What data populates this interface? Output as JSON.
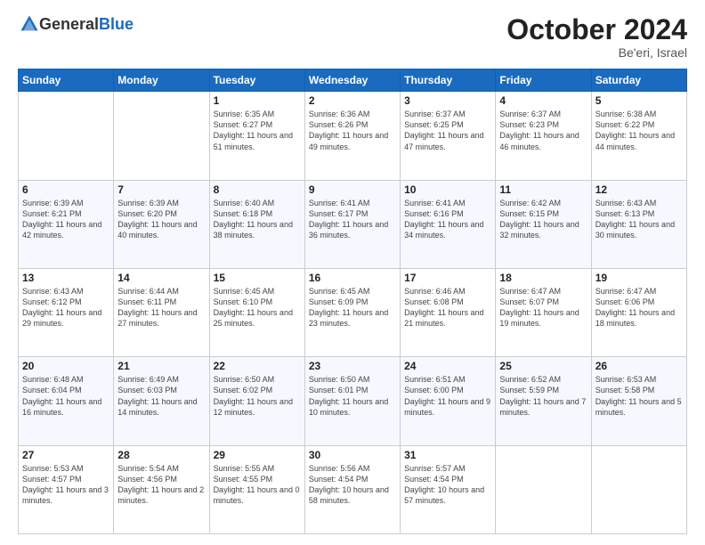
{
  "header": {
    "logo_general": "General",
    "logo_blue": "Blue",
    "month": "October 2024",
    "location": "Be'eri, Israel"
  },
  "days_of_week": [
    "Sunday",
    "Monday",
    "Tuesday",
    "Wednesday",
    "Thursday",
    "Friday",
    "Saturday"
  ],
  "weeks": [
    [
      {
        "day": "",
        "sunrise": "",
        "sunset": "",
        "daylight": ""
      },
      {
        "day": "",
        "sunrise": "",
        "sunset": "",
        "daylight": ""
      },
      {
        "day": "1",
        "sunrise": "Sunrise: 6:35 AM",
        "sunset": "Sunset: 6:27 PM",
        "daylight": "Daylight: 11 hours and 51 minutes."
      },
      {
        "day": "2",
        "sunrise": "Sunrise: 6:36 AM",
        "sunset": "Sunset: 6:26 PM",
        "daylight": "Daylight: 11 hours and 49 minutes."
      },
      {
        "day": "3",
        "sunrise": "Sunrise: 6:37 AM",
        "sunset": "Sunset: 6:25 PM",
        "daylight": "Daylight: 11 hours and 47 minutes."
      },
      {
        "day": "4",
        "sunrise": "Sunrise: 6:37 AM",
        "sunset": "Sunset: 6:23 PM",
        "daylight": "Daylight: 11 hours and 46 minutes."
      },
      {
        "day": "5",
        "sunrise": "Sunrise: 6:38 AM",
        "sunset": "Sunset: 6:22 PM",
        "daylight": "Daylight: 11 hours and 44 minutes."
      }
    ],
    [
      {
        "day": "6",
        "sunrise": "Sunrise: 6:39 AM",
        "sunset": "Sunset: 6:21 PM",
        "daylight": "Daylight: 11 hours and 42 minutes."
      },
      {
        "day": "7",
        "sunrise": "Sunrise: 6:39 AM",
        "sunset": "Sunset: 6:20 PM",
        "daylight": "Daylight: 11 hours and 40 minutes."
      },
      {
        "day": "8",
        "sunrise": "Sunrise: 6:40 AM",
        "sunset": "Sunset: 6:18 PM",
        "daylight": "Daylight: 11 hours and 38 minutes."
      },
      {
        "day": "9",
        "sunrise": "Sunrise: 6:41 AM",
        "sunset": "Sunset: 6:17 PM",
        "daylight": "Daylight: 11 hours and 36 minutes."
      },
      {
        "day": "10",
        "sunrise": "Sunrise: 6:41 AM",
        "sunset": "Sunset: 6:16 PM",
        "daylight": "Daylight: 11 hours and 34 minutes."
      },
      {
        "day": "11",
        "sunrise": "Sunrise: 6:42 AM",
        "sunset": "Sunset: 6:15 PM",
        "daylight": "Daylight: 11 hours and 32 minutes."
      },
      {
        "day": "12",
        "sunrise": "Sunrise: 6:43 AM",
        "sunset": "Sunset: 6:13 PM",
        "daylight": "Daylight: 11 hours and 30 minutes."
      }
    ],
    [
      {
        "day": "13",
        "sunrise": "Sunrise: 6:43 AM",
        "sunset": "Sunset: 6:12 PM",
        "daylight": "Daylight: 11 hours and 29 minutes."
      },
      {
        "day": "14",
        "sunrise": "Sunrise: 6:44 AM",
        "sunset": "Sunset: 6:11 PM",
        "daylight": "Daylight: 11 hours and 27 minutes."
      },
      {
        "day": "15",
        "sunrise": "Sunrise: 6:45 AM",
        "sunset": "Sunset: 6:10 PM",
        "daylight": "Daylight: 11 hours and 25 minutes."
      },
      {
        "day": "16",
        "sunrise": "Sunrise: 6:45 AM",
        "sunset": "Sunset: 6:09 PM",
        "daylight": "Daylight: 11 hours and 23 minutes."
      },
      {
        "day": "17",
        "sunrise": "Sunrise: 6:46 AM",
        "sunset": "Sunset: 6:08 PM",
        "daylight": "Daylight: 11 hours and 21 minutes."
      },
      {
        "day": "18",
        "sunrise": "Sunrise: 6:47 AM",
        "sunset": "Sunset: 6:07 PM",
        "daylight": "Daylight: 11 hours and 19 minutes."
      },
      {
        "day": "19",
        "sunrise": "Sunrise: 6:47 AM",
        "sunset": "Sunset: 6:06 PM",
        "daylight": "Daylight: 11 hours and 18 minutes."
      }
    ],
    [
      {
        "day": "20",
        "sunrise": "Sunrise: 6:48 AM",
        "sunset": "Sunset: 6:04 PM",
        "daylight": "Daylight: 11 hours and 16 minutes."
      },
      {
        "day": "21",
        "sunrise": "Sunrise: 6:49 AM",
        "sunset": "Sunset: 6:03 PM",
        "daylight": "Daylight: 11 hours and 14 minutes."
      },
      {
        "day": "22",
        "sunrise": "Sunrise: 6:50 AM",
        "sunset": "Sunset: 6:02 PM",
        "daylight": "Daylight: 11 hours and 12 minutes."
      },
      {
        "day": "23",
        "sunrise": "Sunrise: 6:50 AM",
        "sunset": "Sunset: 6:01 PM",
        "daylight": "Daylight: 11 hours and 10 minutes."
      },
      {
        "day": "24",
        "sunrise": "Sunrise: 6:51 AM",
        "sunset": "Sunset: 6:00 PM",
        "daylight": "Daylight: 11 hours and 9 minutes."
      },
      {
        "day": "25",
        "sunrise": "Sunrise: 6:52 AM",
        "sunset": "Sunset: 5:59 PM",
        "daylight": "Daylight: 11 hours and 7 minutes."
      },
      {
        "day": "26",
        "sunrise": "Sunrise: 6:53 AM",
        "sunset": "Sunset: 5:58 PM",
        "daylight": "Daylight: 11 hours and 5 minutes."
      }
    ],
    [
      {
        "day": "27",
        "sunrise": "Sunrise: 5:53 AM",
        "sunset": "Sunset: 4:57 PM",
        "daylight": "Daylight: 11 hours and 3 minutes."
      },
      {
        "day": "28",
        "sunrise": "Sunrise: 5:54 AM",
        "sunset": "Sunset: 4:56 PM",
        "daylight": "Daylight: 11 hours and 2 minutes."
      },
      {
        "day": "29",
        "sunrise": "Sunrise: 5:55 AM",
        "sunset": "Sunset: 4:55 PM",
        "daylight": "Daylight: 11 hours and 0 minutes."
      },
      {
        "day": "30",
        "sunrise": "Sunrise: 5:56 AM",
        "sunset": "Sunset: 4:54 PM",
        "daylight": "Daylight: 10 hours and 58 minutes."
      },
      {
        "day": "31",
        "sunrise": "Sunrise: 5:57 AM",
        "sunset": "Sunset: 4:54 PM",
        "daylight": "Daylight: 10 hours and 57 minutes."
      },
      {
        "day": "",
        "sunrise": "",
        "sunset": "",
        "daylight": ""
      },
      {
        "day": "",
        "sunrise": "",
        "sunset": "",
        "daylight": ""
      }
    ]
  ]
}
